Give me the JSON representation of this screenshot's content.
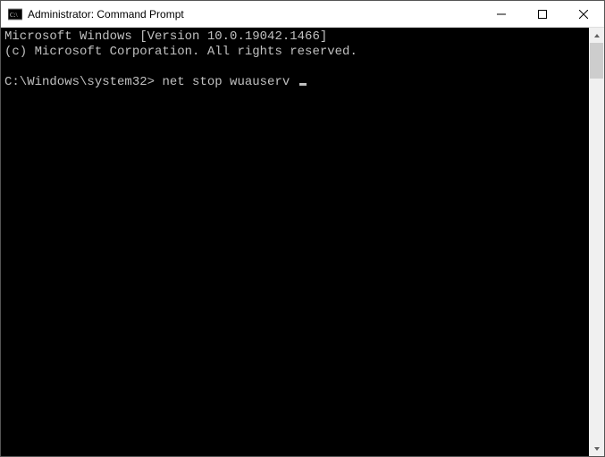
{
  "window": {
    "title": "Administrator: Command Prompt"
  },
  "terminal": {
    "header_line1": "Microsoft Windows [Version 10.0.19042.1466]",
    "header_line2": "(c) Microsoft Corporation. All rights reserved.",
    "prompt": "C:\\Windows\\system32>",
    "command": "net stop wuauserv"
  }
}
